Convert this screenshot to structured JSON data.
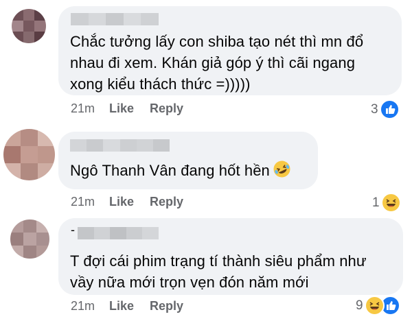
{
  "comments": [
    {
      "text_lines": [
        "Chắc tưởng lấy con shiba tạo nét thì mn đổ",
        "nhau đi xem. Khán giả góp ý thì cãi ngang",
        "xong kiểu thách thức =)))))"
      ],
      "time": "21m",
      "like_label": "Like",
      "reply_label": "Reply",
      "reaction_count": "3",
      "reactions": [
        "like-icon"
      ],
      "avatar_colors": [
        "#6e5056",
        "#8a6b70",
        "#5c4047",
        "#a2868b",
        "#77585e",
        "#94757a",
        "#6b4d53",
        "#866a6e",
        "#5a3d43"
      ],
      "name_blur_colors": [
        "#cdcfd2",
        "#d6d8db",
        "#c8cacd",
        "#d9dbde",
        "#cfd1d4"
      ]
    },
    {
      "text_lines": [
        "Ngô Thanh Vân đang hốt hền"
      ],
      "inline_emoji": "rolling-laughing-emoji",
      "time": "21m",
      "like_label": "Like",
      "reply_label": "Reply",
      "reaction_count": "1",
      "reactions": [
        "haha-icon"
      ],
      "avatar_colors": [
        "#caa59a",
        "#b68d84",
        "#d7b9af",
        "#a8786f",
        "#c59d93",
        "#bf978c",
        "#d4b3aa",
        "#b18a81",
        "#ceada3"
      ],
      "name_blur_colors": [
        "#d3d5d8",
        "#c9cbce",
        "#d8dadd",
        "#cdcfd2",
        "#d1d3d6",
        "#c7c9cc"
      ]
    },
    {
      "text_lines": [
        "T đợi cái phim trạng tí thành siêu phẩm như",
        "vầy nữa mới trọn vẹn đón năm mới"
      ],
      "name_prefix": "-",
      "time": "21m",
      "like_label": "Like",
      "reply_label": "Reply",
      "reaction_count": "9",
      "reactions": [
        "haha-icon",
        "like-icon"
      ],
      "avatar_colors": [
        "#b59c9b",
        "#a48a89",
        "#c6b0ae",
        "#9a7f7e",
        "#bba3a2",
        "#a89090",
        "#c2aba9",
        "#9f8584",
        "#b39a98"
      ],
      "name_blur_colors": [
        "#c4c6c9",
        "#d0d2d5",
        "#bfc1c4",
        "#cbcdd0",
        "#d4d6d9"
      ]
    }
  ],
  "colors": {
    "bubble": "#f0f2f5",
    "meta_text": "#65676b",
    "like_blue": "#1877f2",
    "haha_yellow": "#f7c843"
  }
}
